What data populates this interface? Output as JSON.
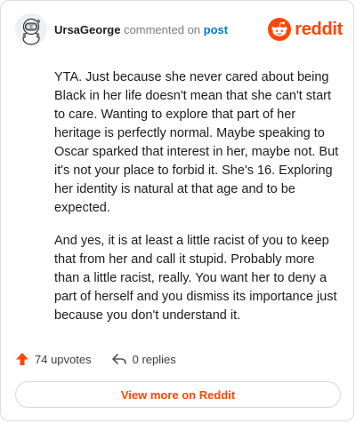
{
  "header": {
    "username": "UrsaGeorge",
    "verb": "commented on",
    "post_link": "post",
    "brand_name": "reddit",
    "brand_color": "#ff4500"
  },
  "comment": {
    "paragraphs": [
      "YTA. Just because she never cared about being Black in her life doesn't mean that she can't start to care. Wanting to explore that part of her heritage is perfectly normal. Maybe speaking to Oscar sparked that interest in her, maybe not. But it's not your place to forbid it. She's 16. Exploring her identity is natural at that age and to be expected.",
      "And yes, it is at least a little racist of you to keep that from her and call it stupid. Probably more than a little racist, really. You want her to deny a part of herself and you dismiss its importance just because you don't understand it."
    ]
  },
  "actions": {
    "upvotes": "74 upvotes",
    "replies": "0 replies",
    "upvote_icon": "upvote-arrow-icon",
    "reply_icon": "reply-arrow-icon"
  },
  "footer": {
    "view_more_label": "View more on Reddit"
  }
}
